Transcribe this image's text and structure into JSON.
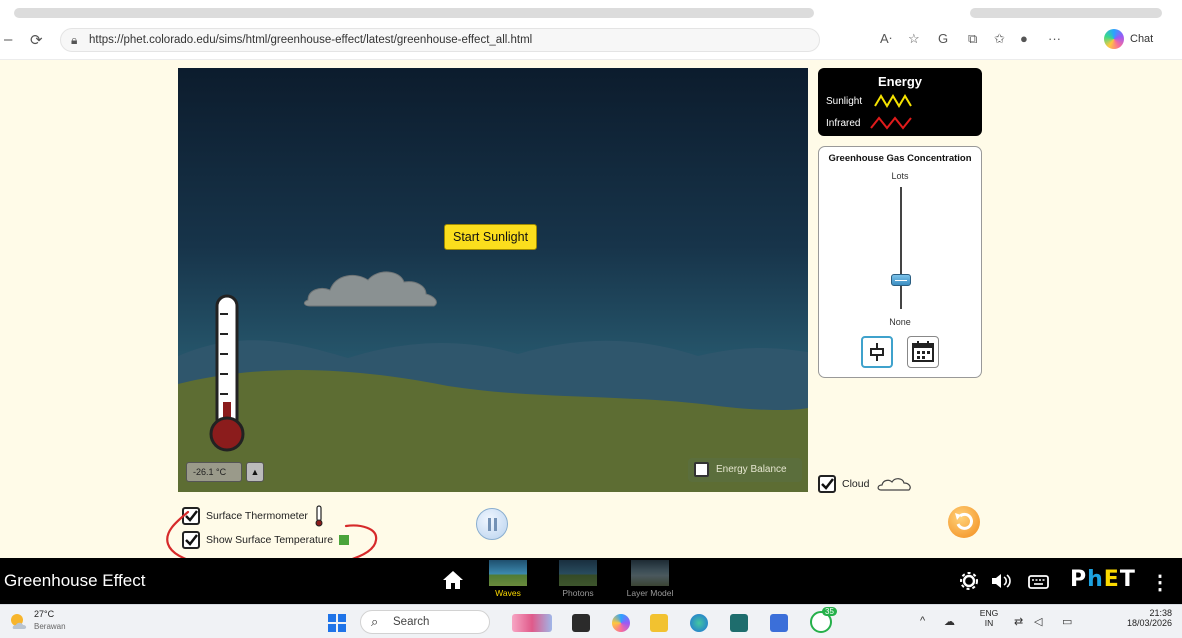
{
  "browser": {
    "url": "https://phet.colorado.edu/sims/html/greenhouse-effect/latest/greenhouse-effect_all.html",
    "chat_label": "Chat"
  },
  "sim": {
    "start_sunlight_label": "Start Sunlight",
    "thermometer_readout": "-26.1 °C",
    "thermometer_toggle_glyph": "▲",
    "energy_balance_label": "Energy Balance",
    "energy_legend": {
      "title": "Energy",
      "sunlight_label": "Sunlight",
      "infrared_label": "Infrared",
      "sunlight_color": "#f5e200",
      "infrared_color": "#e01b1b"
    },
    "ghg_panel": {
      "title": "Greenhouse Gas Concentration",
      "max_label": "Lots",
      "min_label": "None",
      "concentration_level": 0.24
    },
    "cloud_label": "Cloud",
    "surface_thermometer_label": "Surface Thermometer",
    "show_surface_temperature_label": "Show Surface Temperature"
  },
  "phet_bar": {
    "title": "Greenhouse Effect",
    "screens": [
      {
        "label": "Waves",
        "selected": true
      },
      {
        "label": "Photons",
        "selected": false
      },
      {
        "label": "Layer Model",
        "selected": false
      }
    ],
    "logo": {
      "p": "P",
      "h": "h",
      "e": "E",
      "t": "T"
    }
  },
  "taskbar": {
    "weather_temp": "27°C",
    "weather_desc": "Berawan",
    "search_placeholder": "Search",
    "badge_count": "35",
    "lang_top": "ENG",
    "lang_bottom": "IN",
    "time": "21:38",
    "date": "18/03/2026"
  }
}
